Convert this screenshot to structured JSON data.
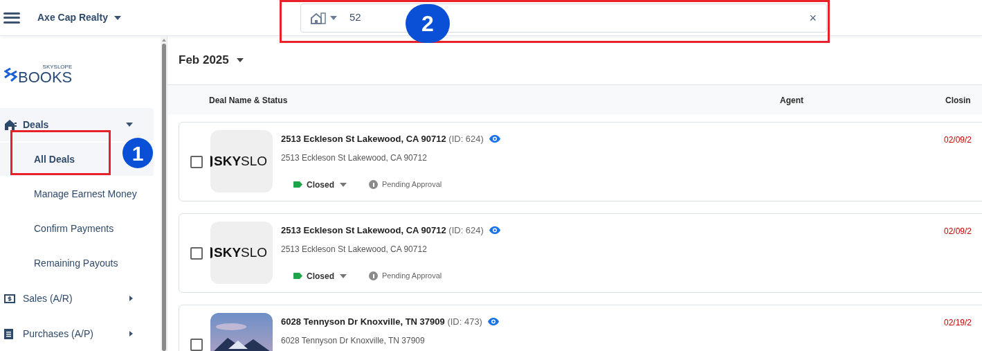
{
  "top_bar": {
    "company": "Axe Cap Realty",
    "search": {
      "value": "52",
      "clear": "×"
    }
  },
  "sidebar": {
    "logo": {
      "small": "SKYSLOPE",
      "large": "BOOKS"
    },
    "items": [
      {
        "label": "Deals",
        "kind": "deals",
        "expanded": true,
        "children": [
          {
            "label": "All Deals",
            "selected": true
          },
          {
            "label": "Manage Earnest Money",
            "selected": false
          },
          {
            "label": "Confirm Payments",
            "selected": false
          },
          {
            "label": "Remaining Payouts",
            "selected": false
          }
        ]
      },
      {
        "label": "Sales (A/R)",
        "kind": "sales",
        "expanded": false
      },
      {
        "label": "Purchases (A/P)",
        "kind": "purchases",
        "expanded": false
      }
    ]
  },
  "period": "Feb 2025",
  "table": {
    "columns": [
      "Deal Name & Status",
      "Agent",
      "Closin"
    ],
    "rows": [
      {
        "thumbnail": {
          "kind": "logo",
          "bold": "SKY",
          "rest": "SLO"
        },
        "title": "2513 Eckleson St Lakewood, CA 90712",
        "id": "(ID: 624)",
        "address": "2513 Eckleson St Lakewood, CA 90712",
        "status": "Closed",
        "color": "#1ea54a",
        "approval": "Pending Approval",
        "closing": "02/09/2",
        "checked": false
      },
      {
        "thumbnail": {
          "kind": "logo",
          "bold": "SKY",
          "rest": "SLO"
        },
        "title": "2513 Eckleson St Lakewood, CA 90712",
        "id": "(ID: 624)",
        "address": "2513 Eckleson St Lakewood, CA 90712",
        "status": "Closed",
        "color": "#1ea54a",
        "approval": "Pending Approval",
        "closing": "02/09/2",
        "checked": false
      },
      {
        "title": "6028 Tennyson Dr Knoxville, TN 37909",
        "id": "(ID: 473)",
        "address": "6028 Tennyson Dr Knoxville, TN 37909",
        "closing": "02/19/2",
        "checked": false
      }
    ]
  },
  "annotations": [
    {
      "label": "1"
    },
    {
      "label": "2"
    }
  ]
}
